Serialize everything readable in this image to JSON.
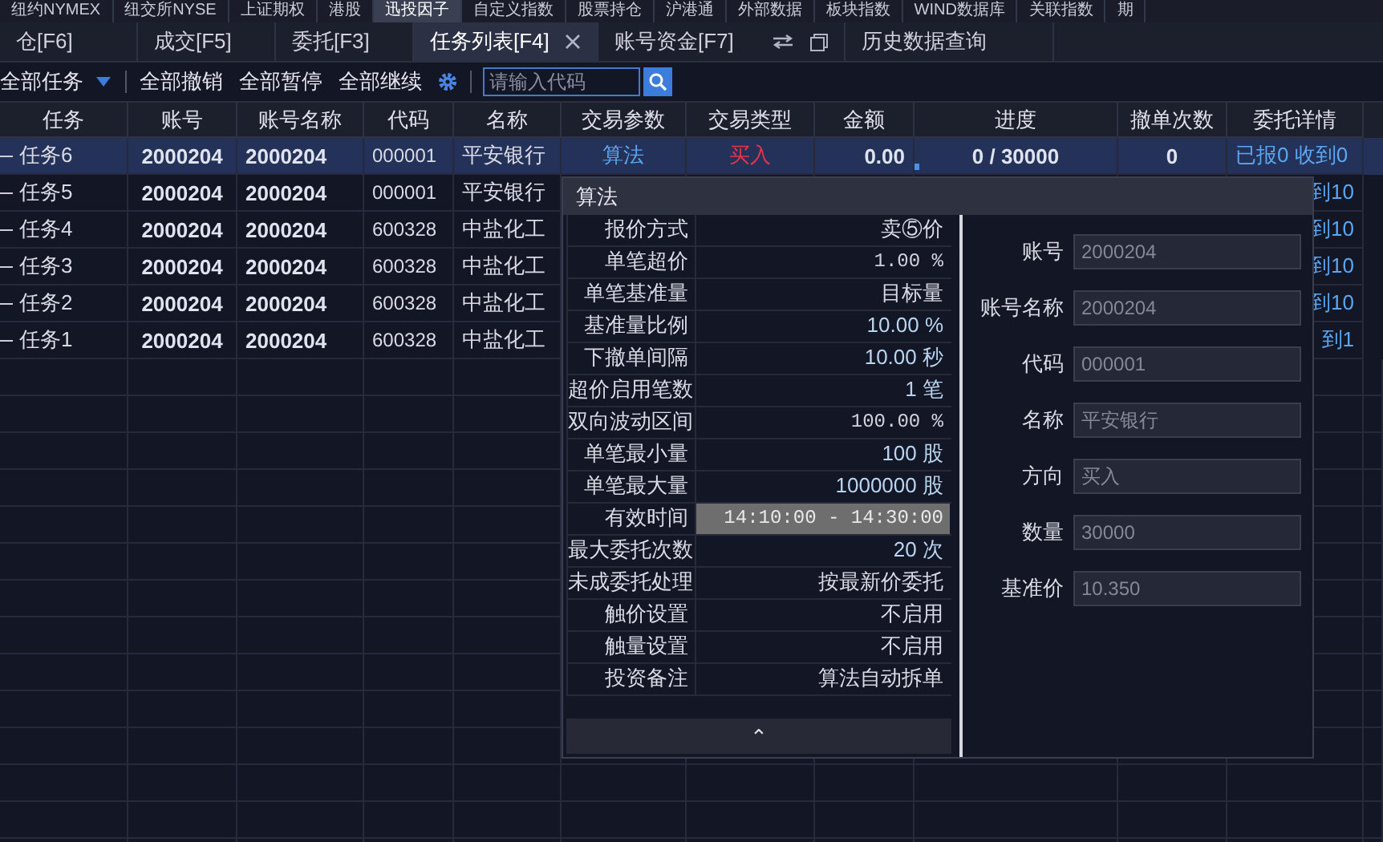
{
  "menu_strip": [
    {
      "label": "纽约NYMEX",
      "selected": false
    },
    {
      "label": "纽交所NYSE",
      "selected": false
    },
    {
      "label": "上证期权",
      "selected": false
    },
    {
      "label": "港股",
      "selected": false
    },
    {
      "label": "迅投因子",
      "selected": true
    },
    {
      "label": "自定义指数",
      "selected": false
    },
    {
      "label": "股票持仓",
      "selected": false
    },
    {
      "label": "沪港通",
      "selected": false
    },
    {
      "label": "外部数据",
      "selected": false
    },
    {
      "label": "板块指数",
      "selected": false
    },
    {
      "label": "WIND数据库",
      "selected": false
    },
    {
      "label": "关联指数",
      "selected": false
    },
    {
      "label": "期",
      "selected": false
    }
  ],
  "tabs": [
    {
      "label": "仓[F6]",
      "selected": false
    },
    {
      "label": "成交[F5]",
      "selected": false
    },
    {
      "label": "委托[F3]",
      "selected": false
    },
    {
      "label": "任务列表[F4]",
      "selected": true,
      "closable": true
    },
    {
      "label": "账号资金[F7]",
      "selected": false,
      "tools": true
    },
    {
      "label": "历史数据查询",
      "selected": false
    }
  ],
  "toolbar": {
    "filter": "全部任务",
    "buttons": [
      "全部撤销",
      "全部暂停",
      "全部继续"
    ],
    "search": {
      "placeholder": "请输入代码"
    }
  },
  "table": {
    "columns": [
      "任务",
      "账号",
      "账号名称",
      "代码",
      "名称",
      "交易参数",
      "交易类型",
      "金额",
      "进度",
      "撤单次数",
      "委托详情"
    ],
    "rows": [
      {
        "selected": true,
        "task": "任务6",
        "account": "2000204",
        "account_name": "2000204",
        "code": "000001",
        "name": "平安银行",
        "params": "算法",
        "type": "买入",
        "amount": "0.00",
        "progress": "0 / 30000",
        "level": 0,
        "cancels": "0",
        "detail": "已报0 收到0"
      },
      {
        "selected": false,
        "task": "任务5",
        "account": "2000204",
        "account_name": "2000204",
        "code": "000001",
        "name": "平安银行",
        "detail": "到10"
      },
      {
        "selected": false,
        "task": "任务4",
        "account": "2000204",
        "account_name": "2000204",
        "code": "600328",
        "name": "中盐化工",
        "detail": "到10"
      },
      {
        "selected": false,
        "task": "任务3",
        "account": "2000204",
        "account_name": "2000204",
        "code": "600328",
        "name": "中盐化工",
        "detail": "到10"
      },
      {
        "selected": false,
        "task": "任务2",
        "account": "2000204",
        "account_name": "2000204",
        "code": "600328",
        "name": "中盐化工",
        "detail": "到10"
      },
      {
        "selected": false,
        "task": "任务1",
        "account": "2000204",
        "account_name": "2000204",
        "code": "600328",
        "name": "中盐化工",
        "detail": "到1"
      }
    ]
  },
  "popup": {
    "title": "算法",
    "params": [
      {
        "label": "报价方式",
        "value": "卖⑤价",
        "kind": "text"
      },
      {
        "label": "单笔超价",
        "value": "1.00 %",
        "kind": "mono"
      },
      {
        "label": "单笔基准量",
        "value": "目标量",
        "kind": "text"
      },
      {
        "label": "基准量比例",
        "value": "10.00 %",
        "kind": "number"
      },
      {
        "label": "下撤单间隔",
        "value": "10.00 秒",
        "kind": "number"
      },
      {
        "label": "超价启用笔数",
        "value": "1 笔",
        "kind": "number"
      },
      {
        "label": "双向波动区间",
        "value": "100.00 %",
        "kind": "mono"
      },
      {
        "label": "单笔最小量",
        "value": "100 股",
        "kind": "number"
      },
      {
        "label": "单笔最大量",
        "value": "1000000 股",
        "kind": "number"
      },
      {
        "label": "有效时间",
        "value": "14:10:00 - 14:30:00",
        "kind": "time"
      },
      {
        "label": "最大委托次数",
        "value": "20 次",
        "kind": "number"
      },
      {
        "label": "未成委托处理",
        "value": "按最新价委托",
        "kind": "text"
      },
      {
        "label": "触价设置",
        "value": "不启用",
        "kind": "text"
      },
      {
        "label": "触量设置",
        "value": "不启用",
        "kind": "text"
      },
      {
        "label": "投资备注",
        "value": "算法自动拆单",
        "kind": "text"
      }
    ],
    "collapse": "⌃",
    "fields": [
      {
        "label": "账号",
        "value": "2000204"
      },
      {
        "label": "账号名称",
        "value": "2000204"
      },
      {
        "label": "代码",
        "value": "000001"
      },
      {
        "label": "名称",
        "value": "平安银行"
      },
      {
        "label": "方向",
        "value": "买入"
      },
      {
        "label": "数量",
        "value": "30000"
      },
      {
        "label": "基准价",
        "value": "10.350"
      }
    ]
  }
}
